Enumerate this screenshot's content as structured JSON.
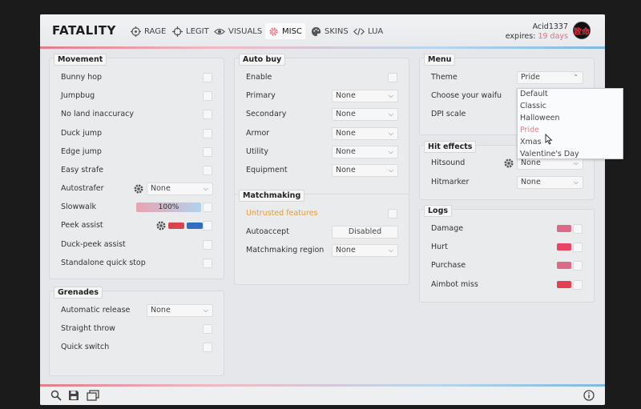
{
  "header": {
    "logo": "FATALITY",
    "tabs": [
      {
        "label": "RAGE",
        "icon": "crosshair-target-icon"
      },
      {
        "label": "LEGIT",
        "icon": "crosshair-icon"
      },
      {
        "label": "VISUALS",
        "icon": "eye-icon"
      },
      {
        "label": "MISC",
        "icon": "gear-icon",
        "active": true
      },
      {
        "label": "SKINS",
        "icon": "palette-icon"
      },
      {
        "label": "LUA",
        "icon": "code-icon"
      }
    ],
    "username": "Acid1337",
    "expires_label": "expires:",
    "expires_value": "19 days",
    "avatar_text": "致命"
  },
  "movement": {
    "title": "Movement",
    "bunny_hop": "Bunny hop",
    "jumpbug": "Jumpbug",
    "no_land_inaccuracy": "No land inaccuracy",
    "duck_jump": "Duck jump",
    "edge_jump": "Edge jump",
    "easy_strafe": "Easy strafe",
    "autostrafer": "Autostrafer",
    "autostrafer_value": "None",
    "slowwalk": "Slowwalk",
    "slowwalk_value": "100%",
    "slowwalk_fraction": 1.0,
    "peek_assist": "Peek assist",
    "peek_color_1": "#d8434f",
    "peek_color_2": "#2e6fc2",
    "duck_peek_assist": "Duck-peek assist",
    "standalone_quick_stop": "Standalone quick stop"
  },
  "grenades": {
    "title": "Grenades",
    "automatic_release": "Automatic release",
    "automatic_release_value": "None",
    "straight_throw": "Straight throw",
    "quick_switch": "Quick switch"
  },
  "autobuy": {
    "title": "Auto buy",
    "enable": "Enable",
    "primary": "Primary",
    "primary_value": "None",
    "secondary": "Secondary",
    "secondary_value": "None",
    "armor": "Armor",
    "armor_value": "None",
    "utility": "Utility",
    "utility_value": "None",
    "equipment": "Equipment",
    "equipment_value": "None"
  },
  "matchmaking": {
    "title": "Matchmaking",
    "untrusted_features": "Untrusted features",
    "autoaccept": "Autoaccept",
    "autoaccept_value": "Disabled",
    "region": "Matchmaking region",
    "region_value": "None"
  },
  "menu": {
    "title": "Menu",
    "theme": "Theme",
    "theme_value": "Pride",
    "waifu": "Choose your waifu",
    "dpi_scale": "DPI scale",
    "theme_options": [
      "Default",
      "Classic",
      "Halloween",
      "Pride",
      "Xmas",
      "Valentine's Day"
    ]
  },
  "hit_effects": {
    "title": "Hit effects",
    "hitsound": "Hitsound",
    "hitsound_value": "None",
    "hitmarker": "Hitmarker",
    "hitmarker_value": "None"
  },
  "logs": {
    "title": "Logs",
    "damage": "Damage",
    "hurt": "Hurt",
    "purchase": "Purchase",
    "aimbot_miss": "Aimbot miss",
    "colors": [
      "#dd6b87",
      "#e64563",
      "#dd6b87",
      "#e0434f"
    ]
  },
  "colors": {
    "accent_pink": "#e07f8c",
    "accent_blue": "#7fb8e0",
    "warning_orange": "#e39b3a"
  }
}
